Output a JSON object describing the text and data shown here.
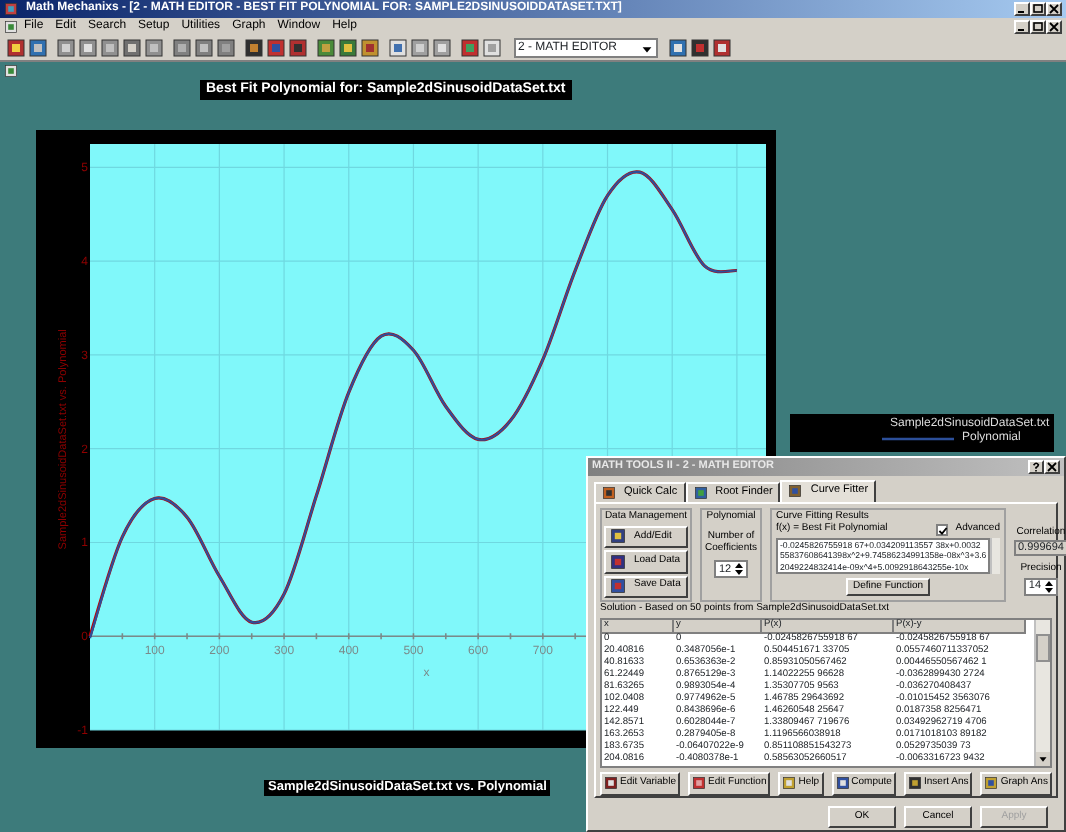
{
  "window": {
    "title": "Math Mechanixs - [2 - MATH EDITOR - BEST FIT POLYNOMIAL FOR: SAMPLE2DSINUSOIDDATASET.TXT]"
  },
  "menu": [
    "File",
    "Edit",
    "Search",
    "Setup",
    "Utilities",
    "Graph",
    "Window",
    "Help"
  ],
  "toolbar": {
    "document_select": "2 - MATH EDITOR"
  },
  "graph": {
    "title": "Best Fit Polynomial for: Sample2dSinusoidDataSet.txt",
    "caption": "Sample2dSinusoidDataSet.txt vs. Polynomial",
    "chart_data": {
      "type": "line",
      "grid": true,
      "xlabel": "x",
      "ylabel": "Sample2dSinusoidDataSet.txt vs. Polynomial",
      "x": [
        0,
        50,
        100,
        150,
        200,
        250,
        300,
        350,
        400,
        450,
        500,
        550,
        600,
        650,
        700,
        750,
        800,
        850,
        900,
        950,
        1000
      ],
      "series": [
        {
          "name": "Sample2dSinusoidDataSet.txt",
          "color": "#c00000",
          "values": [
            0,
            1.06,
            1.47,
            1.27,
            0.64,
            0.15,
            0.45,
            1.5,
            2.6,
            3.2,
            3.05,
            2.45,
            2.1,
            2.3,
            2.95,
            3.9,
            4.7,
            4.95,
            4.55,
            3.95,
            3.9
          ]
        },
        {
          "name": "Polynomial",
          "color": "#2c4f9a",
          "values": [
            -0.02,
            1.06,
            1.47,
            1.27,
            0.64,
            0.15,
            0.45,
            1.5,
            2.6,
            3.2,
            3.05,
            2.45,
            2.1,
            2.3,
            2.95,
            3.9,
            4.7,
            4.95,
            4.55,
            3.95,
            3.9
          ]
        }
      ],
      "xlim": [
        0,
        1045
      ],
      "ylim": [
        -1,
        5.25
      ],
      "xticks": [
        100,
        200,
        300,
        400,
        500,
        600,
        700
      ],
      "yticks": [
        -1,
        0,
        1,
        2,
        3,
        4,
        5
      ]
    }
  },
  "dialog": {
    "title": "MATH TOOLS II - 2 - MATH EDITOR",
    "tabs": [
      {
        "label": "Quick Calc",
        "selected": false
      },
      {
        "label": "Root Finder",
        "selected": false
      },
      {
        "label": "Curve Fitter",
        "selected": true
      }
    ],
    "data_management": {
      "title": "Data Management",
      "buttons": [
        "Add/Edit",
        "Load Data",
        "Save Data"
      ]
    },
    "polynomial": {
      "title": "Polynomial",
      "label": "Number of Coefficients",
      "value": "12"
    },
    "results": {
      "title": "Curve Fitting Results",
      "function_label": "f(x) = Best Fit Polynomial",
      "advanced": {
        "label": "Advanced",
        "checked": true
      },
      "formula": [
        "-0.0245826755918 67+0.034209113557 38x+0.0032",
        "55837608641398x^2+9.74586234991358e-08x^3+3.6",
        "2049224832414e-09x^4+5.0092918643255e-10x"
      ],
      "define_button": "Define Function"
    },
    "correlation": {
      "label": "Correlation",
      "value": "0.999694"
    },
    "precision": {
      "label": "Precision",
      "value": "14"
    },
    "solution_label": "Solution - Based on 50 points from Sample2dSinusoidDataSet.txt",
    "table": {
      "columns": [
        "x",
        "y",
        "P(x)",
        "P(x)-y"
      ],
      "rows": [
        [
          "0",
          "0",
          "-0.0245826755918 67",
          "-0.0245826755918 67"
        ],
        [
          "20.40816",
          "0.3487056e-1",
          "0.504451671 33705",
          "0.0557460711337052"
        ],
        [
          "40.81633",
          "0.6536363e-2",
          "0.85931050567462",
          "0.00446550567462 1"
        ],
        [
          "61.22449",
          "0.8765129e-3",
          "1.14022255 96628",
          "-0.0362899430 2724"
        ],
        [
          "81.63265",
          "0.9893054e-4",
          "1.35307705 9563",
          "-0.036270408437"
        ],
        [
          "102.0408",
          "0.9774962e-5",
          "1.46785 29643692",
          "-0.01015452 3563076"
        ],
        [
          "122.449",
          "0.8438696e-6",
          "1.46260548 25647",
          "0.0187358 8256471"
        ],
        [
          "142.8571",
          "0.6028044e-7",
          "1.33809467 719676",
          "0.03492962719 4706"
        ],
        [
          "163.2653",
          "0.2879405e-8",
          "1.1196566038918",
          "0.0171018103 89182"
        ],
        [
          "183.6735",
          "-0.06407022e-9",
          "0.851108851543273",
          "0.0529735039 73"
        ],
        [
          "204.0816",
          "-0.4080378e-1",
          "0.58563052660517",
          "-0.0063316723 9432"
        ]
      ]
    },
    "tools": [
      "Edit Variable",
      "Edit Function",
      "Help",
      "Compute",
      "Insert Ans",
      "Graph Ans"
    ],
    "buttons": [
      {
        "label": "OK",
        "disabled": false
      },
      {
        "label": "Cancel",
        "disabled": false
      },
      {
        "label": "Apply",
        "disabled": true
      }
    ]
  }
}
